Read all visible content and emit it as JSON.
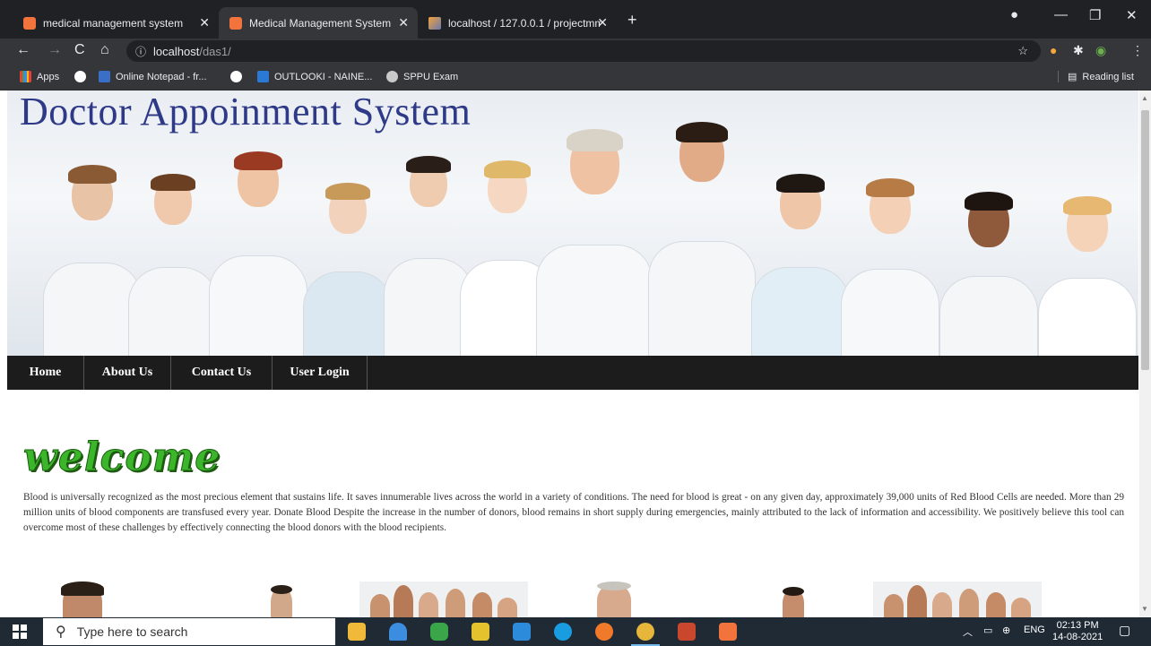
{
  "browser": {
    "tabs": [
      {
        "title": "medical management system"
      },
      {
        "title": "Medical Management System"
      },
      {
        "title": "localhost / 127.0.0.1 / projectmm"
      }
    ],
    "url_host": "localhost",
    "url_path": "/das1/",
    "bookmarks": [
      {
        "label": "Apps"
      },
      {
        "label": ""
      },
      {
        "label": "Online Notepad - fr..."
      },
      {
        "label": ""
      },
      {
        "label": "OUTLOOKI - NAINE..."
      },
      {
        "label": "SPPU Exam"
      }
    ],
    "reading_list": "Reading list"
  },
  "site": {
    "title": "Doctor Appoinment System",
    "nav": [
      {
        "label": "Home"
      },
      {
        "label": "About Us"
      },
      {
        "label": "Contact Us"
      },
      {
        "label": "User Login"
      }
    ],
    "welcome": "welcome",
    "intro": "Blood is universally recognized as the most precious element that sustains life. It saves innumerable lives across the world in a variety of conditions. The need for blood is great - on any given day, approximately 39,000 units of Red Blood Cells are needed. More than 29 million units of blood components are transfused every year. Donate Blood Despite the increase in the number of donors, blood remains in short supply during emergencies, mainly attributed to the lack of information and accessibility. We positively believe this tool can overcome most of these challenges by effectively connecting the blood donors with the blood recipients."
  },
  "taskbar": {
    "search_placeholder": "Type here to search",
    "language": "ENG",
    "time": "02:13 PM",
    "date": "14-08-2021"
  },
  "colors": {
    "site_title": "#2e3a87",
    "menubar": "#1c1c1c",
    "welcome": "#3bb52a"
  }
}
